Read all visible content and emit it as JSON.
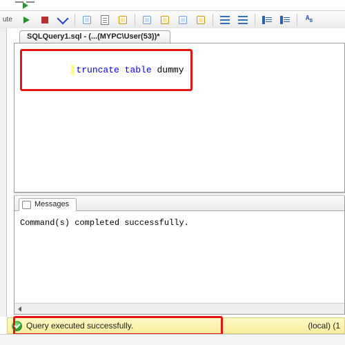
{
  "toolbar": {
    "partial_label": "ute"
  },
  "tab": {
    "label": "SQLQuery1.sql - (...(MYPC\\User(53))*"
  },
  "sql": {
    "kw1": "truncate",
    "kw2": "table",
    "ident": "dummy"
  },
  "messages": {
    "tab_label": "Messages",
    "body": "Command(s) completed successfully."
  },
  "status": {
    "text": "Query executed successfully.",
    "right": "(local) (1"
  },
  "icons": {
    "play": "play-icon",
    "stop": "stop-icon",
    "check": "check-icon"
  }
}
